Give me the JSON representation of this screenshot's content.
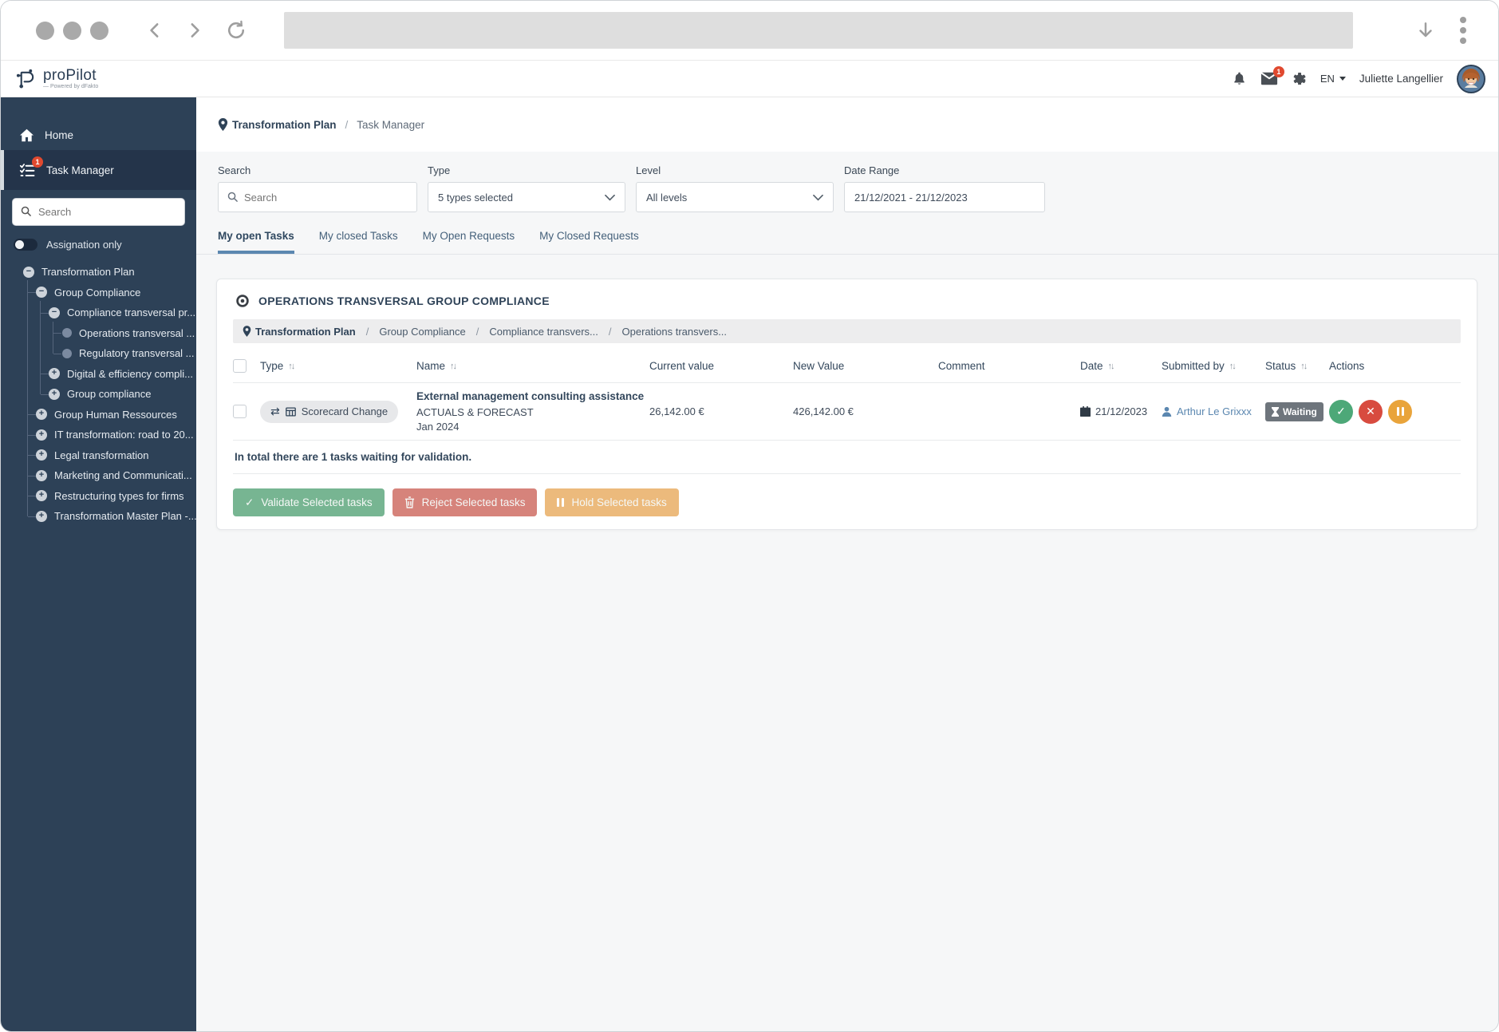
{
  "colors": {
    "accent": "#5B87B0",
    "sidebar": "#2D4157",
    "sidebar-active": "#24344A",
    "navy": "#33475C",
    "success": "#4DA878",
    "danger": "#D84B3F",
    "warning": "#E9A43B",
    "success-muted": "#77B592",
    "danger-muted": "#D6837B",
    "warning-muted": "#ECBA7C",
    "badge": "#E0492F",
    "status": "#6E757C"
  },
  "header": {
    "logo_title": "proPilot",
    "logo_sub": "— Powered by dFakto",
    "mail_badge": "1",
    "lang": "EN",
    "user": "Juliette Langellier"
  },
  "sidebar": {
    "home_label": "Home",
    "taskmanager_label": "Task Manager",
    "taskmanager_badge": "1",
    "search_placeholder": "Search",
    "toggle_label": "Assignation only",
    "tree": [
      {
        "label": "Transformation Plan",
        "level": 0,
        "icon": "minus"
      },
      {
        "label": "Group Compliance",
        "level": 1,
        "icon": "minus"
      },
      {
        "label": "Compliance transversal pr...",
        "level": 2,
        "icon": "minus"
      },
      {
        "label": "Operations transversal ...",
        "level": 3,
        "icon": "dot"
      },
      {
        "label": "Regulatory transversal ...",
        "level": 3,
        "icon": "dot"
      },
      {
        "label": "Digital & efficiency compli...",
        "level": 2,
        "icon": "plus"
      },
      {
        "label": "Group compliance",
        "level": 2,
        "icon": "plus"
      },
      {
        "label": "Group Human Ressources",
        "level": 1,
        "icon": "plus"
      },
      {
        "label": "IT transformation: road to 20...",
        "level": 1,
        "icon": "plus"
      },
      {
        "label": "Legal transformation",
        "level": 1,
        "icon": "plus"
      },
      {
        "label": "Marketing and Communicati...",
        "level": 1,
        "icon": "plus"
      },
      {
        "label": "Restructuring types for firms",
        "level": 1,
        "icon": "plus"
      },
      {
        "label": "Transformation Master Plan -...",
        "level": 1,
        "icon": "plus"
      }
    ]
  },
  "breadcrumb": {
    "root": "Transformation Plan",
    "current": "Task Manager"
  },
  "filters": {
    "search_label": "Search",
    "search_placeholder": "Search",
    "type_label": "Type",
    "type_value": "5 types selected",
    "level_label": "Level",
    "level_value": "All levels",
    "date_label": "Date Range",
    "date_value": "21/12/2021 - 21/12/2023"
  },
  "tabs": [
    {
      "label": "My open Tasks",
      "active": true
    },
    {
      "label": "My closed Tasks",
      "active": false
    },
    {
      "label": "My Open Requests",
      "active": false
    },
    {
      "label": "My Closed Requests",
      "active": false
    }
  ],
  "card": {
    "title": "OPERATIONS TRANSVERSAL GROUP COMPLIANCE",
    "crumbs": [
      "Transformation Plan",
      "Group Compliance",
      "Compliance transvers...",
      "Operations transvers..."
    ],
    "columns": [
      {
        "label": "Type",
        "sortable": true
      },
      {
        "label": "Name",
        "sortable": true
      },
      {
        "label": "Current value",
        "sortable": false
      },
      {
        "label": "New Value",
        "sortable": false
      },
      {
        "label": "Comment",
        "sortable": false
      },
      {
        "label": "Date",
        "sortable": true
      },
      {
        "label": "Submitted by",
        "sortable": true
      },
      {
        "label": "Status",
        "sortable": true
      },
      {
        "label": "Actions",
        "sortable": false
      }
    ],
    "row": {
      "type_badge": "Scorecard Change",
      "name_title": "External management consulting assistance",
      "name_sub1": "ACTUALS & FORECAST",
      "name_sub2": "Jan 2024",
      "current_value": "26,142.00 €",
      "new_value": "426,142.00 €",
      "comment": "",
      "date": "21/12/2023",
      "submitted_by": "Arthur Le Grixxx",
      "status": "Waiting"
    },
    "summary": "In total there are 1 tasks waiting for validation.",
    "actions": {
      "validate": "Validate Selected tasks",
      "reject": "Reject Selected tasks",
      "hold": "Hold Selected tasks"
    }
  }
}
